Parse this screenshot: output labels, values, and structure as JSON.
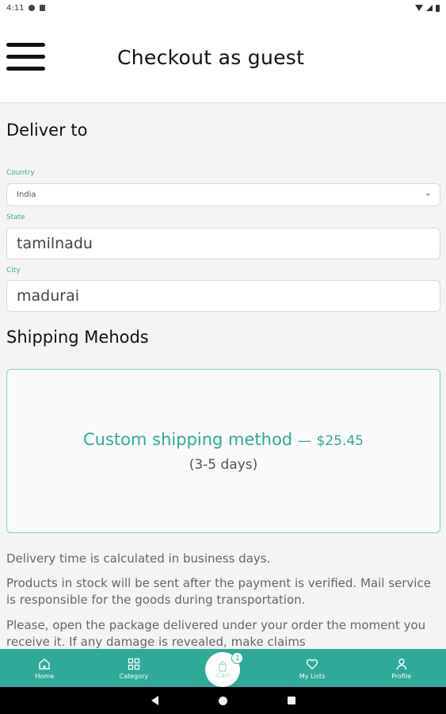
{
  "status_bar": {
    "time": "4:11"
  },
  "header": {
    "title": "Checkout as guest"
  },
  "deliver": {
    "title": "Deliver to",
    "country_label": "Country",
    "country_value": "India",
    "state_label": "State",
    "state_value": "tamilnadu",
    "city_label": "City",
    "city_value": "madurai"
  },
  "shipping": {
    "title": "Shipping Mehods",
    "method_name": "Custom shipping method",
    "separator": "—",
    "price": "$25.45",
    "days": "(3-5 days)"
  },
  "info": {
    "line1": "Delivery time is calculated in business days.",
    "line2": "Products in stock will be sent after the payment is verified. Mail service is responsible for the goods during transportation.",
    "line3": "Please, open the package delivered under your order the moment you receive it. If any damage is revealed, make claims"
  },
  "bottom_nav": {
    "home": "Home",
    "category": "Category",
    "cart": "Cart",
    "cart_count": "1",
    "my_lists": "My Lists",
    "profile": "Profile"
  },
  "colors": {
    "accent": "#2eaa9b"
  }
}
